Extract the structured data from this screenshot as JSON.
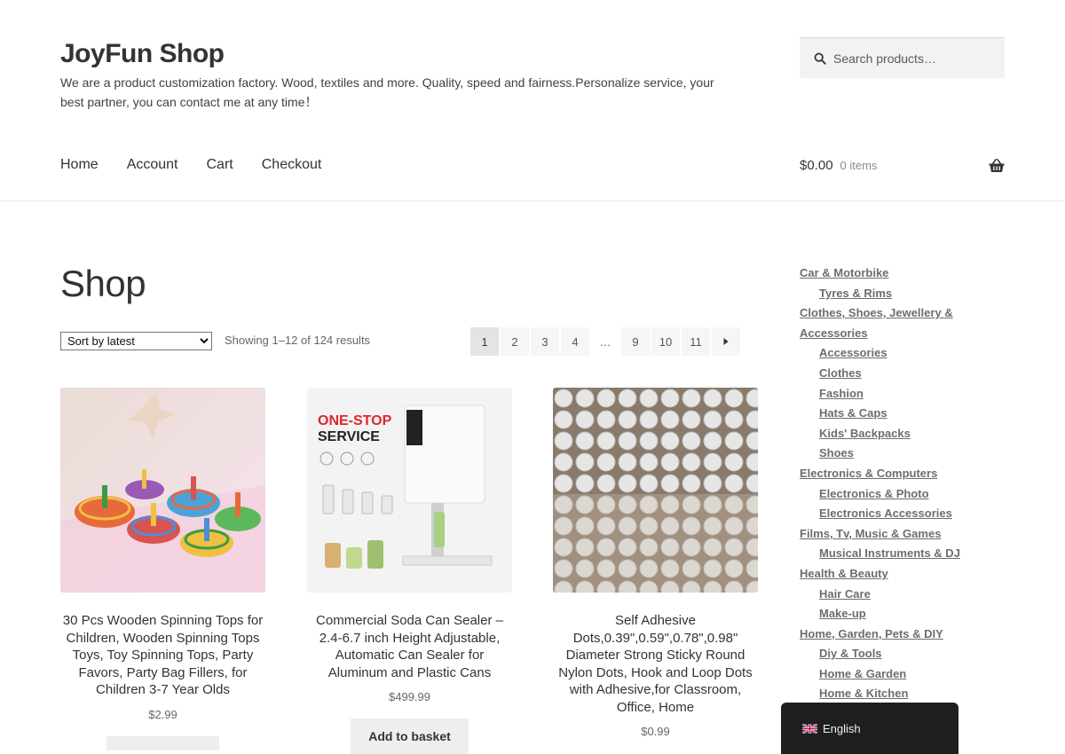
{
  "header": {
    "site_title": "JoyFun Shop",
    "tagline": "We are a product customization factory. Wood, textiles and more. Quality, speed and fairness.Personalize service, your best partner, you can contact me at any time！",
    "search_placeholder": "Search products…",
    "search_icon": "search-icon"
  },
  "nav": {
    "items": [
      {
        "label": "Home"
      },
      {
        "label": "Account"
      },
      {
        "label": "Cart"
      },
      {
        "label": "Checkout"
      }
    ]
  },
  "cart": {
    "amount": "$0.00",
    "count": "0 items",
    "icon": "basket-icon"
  },
  "shop": {
    "title": "Shop",
    "sort_selected": "Sort by latest",
    "result_count": "Showing 1–12 of 124 results"
  },
  "pagination": {
    "pages": [
      "1",
      "2",
      "3",
      "4",
      "…",
      "9",
      "10",
      "11"
    ],
    "current": "1",
    "next_icon": "next-arrow-icon"
  },
  "products": [
    {
      "title": "30 Pcs Wooden Spinning Tops for Children, Wooden Spinning Tops Toys, Toy Spinning Tops, Party Favors, Party Bag Fillers, for Children 3-7 Year Olds",
      "price": "$2.99",
      "button": ""
    },
    {
      "title": "Commercial Soda Can Sealer – 2.4-6.7 inch Height Adjustable, Automatic Can Sealer for Aluminum and Plastic Cans",
      "price": "$499.99",
      "button": "Add to basket",
      "image_text": {
        "line1": "ONE-STOP",
        "line2": "SERVICE"
      }
    },
    {
      "title": "Self Adhesive Dots,0.39\",0.59\",0.78\",0.98\" Diameter Strong Sticky Round Nylon Dots, Hook and Loop Dots with Adhesive,for Classroom, Office, Home",
      "price": "$0.99",
      "button": ""
    }
  ],
  "sidebar": {
    "categories": [
      {
        "label": "Car & Motorbike",
        "level": 0
      },
      {
        "label": "Tyres & Rims",
        "level": 1
      },
      {
        "label": "Clothes, Shoes, Jewellery & Accessories",
        "level": 0
      },
      {
        "label": "Accessories",
        "level": 1
      },
      {
        "label": "Clothes",
        "level": 1
      },
      {
        "label": "Fashion",
        "level": 1
      },
      {
        "label": "Hats & Caps",
        "level": 1
      },
      {
        "label": "Kids' Backpacks",
        "level": 1
      },
      {
        "label": "Shoes",
        "level": 1
      },
      {
        "label": "Electronics & Computers",
        "level": 0
      },
      {
        "label": "Electronics & Photo",
        "level": 1
      },
      {
        "label": "Electronics Accessories",
        "level": 1
      },
      {
        "label": "Films, Tv, Music & Games",
        "level": 0
      },
      {
        "label": "Musical Instruments & DJ",
        "level": 1
      },
      {
        "label": "Health & Beauty",
        "level": 0
      },
      {
        "label": "Hair Care",
        "level": 1
      },
      {
        "label": "Make-up",
        "level": 1
      },
      {
        "label": "Home, Garden, Pets & DIY",
        "level": 0
      },
      {
        "label": "Diy & Tools",
        "level": 1
      },
      {
        "label": "Home & Garden",
        "level": 1
      },
      {
        "label": "Home & Kitchen",
        "level": 1
      }
    ]
  },
  "language": {
    "label": "English",
    "flag_icon": "uk-flag-icon"
  },
  "colors": {
    "text": "#333333",
    "muted": "#6d6d6d",
    "button_bg": "#eeeeee",
    "lang_bg": "#1f1f1f",
    "accent_red": "#e0262a"
  }
}
